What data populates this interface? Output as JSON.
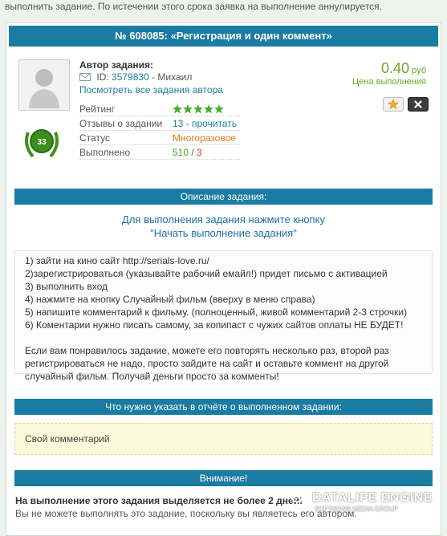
{
  "top_note": "выполнить задание. По истечении этого срока заявка на выполнение аннулируется.",
  "task": {
    "title": "№ 608085: «Регистрация и один коммент»",
    "price_value": "0.40",
    "price_unit": "руб",
    "price_label": "Цена выполнения"
  },
  "author": {
    "label": "Автор задания:",
    "id_prefix": "ID:",
    "id": "3579830",
    "name": "- Михаил",
    "all_tasks_link": "Посмотреть все задания автора",
    "level_badge": "33"
  },
  "info": {
    "rating_label": "Рейтинг",
    "rating_stars": 5,
    "reviews_label": "Отзывы о задании",
    "reviews_value": "13 - прочитать",
    "status_label": "Статус",
    "status_value": "Многоразовое",
    "done_label": "Выполнено",
    "done_ok": "510",
    "done_sep": " / ",
    "done_bad": "3"
  },
  "description": {
    "header": "Описание задания:",
    "heading_line1": "Для выполнения задания нажмите кнопку",
    "heading_line2": "\"Начать выполнение задания\"",
    "steps": [
      "1) зайти на кино сайт http://serials-love.ru/",
      "2)зарегистрироваться (указывайте рабочий емайл!) придет письмо с активацией",
      "3) выполнить вход",
      "4) нажмите на кнопку Случайный фильм (вверху в меню справа)",
      "5) напишите комментарий к фильму. (полноценный, живой комментарий 2-3 строчки)",
      "6) Коментарии нужно писать самому, за копипаст с чужих сайтов оплаты НЕ БУДЕТ!"
    ],
    "note_line1": "Если вам понравилось задание, можете его повторять несколько раз, второй раз",
    "note_line2": "регистрироваться не надо, просто зайдите на сайт и оставьте коммент на другой",
    "note_line3": "случайный фильм. Получай деньги просто за комменты!"
  },
  "report": {
    "header": "Что нужно указать в отчёте о выполненном задании:",
    "value": "Свой комментарий"
  },
  "warning": {
    "header": "Внимание!",
    "bold_text": "На выполнение этого задания выделяется не более 2 дней!",
    "text": "Вы не можете выполнять это задание, поскольку вы являетесь его автором."
  },
  "watermark": {
    "title": "DATALIFE ENGINE",
    "subtitle": "SOFTNEWS MEDIA GROUP"
  },
  "colors": {
    "accent_bar": "#1a7ca3",
    "price_green": "#6aa81e",
    "link_blue": "#1d7d9e",
    "status_orange": "#e07a10",
    "fail_red": "#d0302b"
  }
}
